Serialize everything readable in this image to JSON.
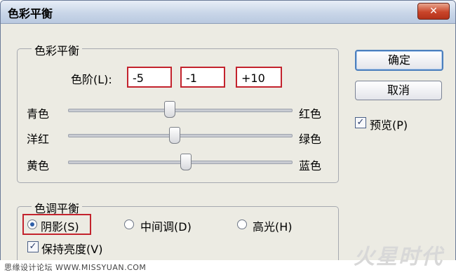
{
  "window": {
    "title": "色彩平衡",
    "close_glyph": "✕"
  },
  "color_balance": {
    "group_title": "色彩平衡",
    "levels_label": "色阶(L):",
    "levels": [
      "-5",
      "-1",
      "+10"
    ],
    "sliders": [
      {
        "left": "青色",
        "right": "红色",
        "value": -5
      },
      {
        "left": "洋红",
        "right": "绿色",
        "value": -1
      },
      {
        "left": "黄色",
        "right": "蓝色",
        "value": 10
      }
    ]
  },
  "tone_balance": {
    "group_title": "色调平衡",
    "options": [
      {
        "label": "阴影(S)",
        "selected": true
      },
      {
        "label": "中间调(D)",
        "selected": false
      },
      {
        "label": "高光(H)",
        "selected": false
      }
    ],
    "preserve_luminosity": {
      "label": "保持亮度(V)",
      "checked": true
    }
  },
  "buttons": {
    "ok": "确定",
    "cancel": "取消"
  },
  "preview": {
    "label": "预览(P)",
    "checked": true
  },
  "watermark": {
    "left": "思缘设计论坛 WWW.MISSYUAN.COM",
    "right": "火星时代"
  },
  "colors": {
    "highlight": "#c3232d",
    "title_bar": "#c9d6e8",
    "close": "#c9452a",
    "dialog_bg": "#ecebe3"
  }
}
